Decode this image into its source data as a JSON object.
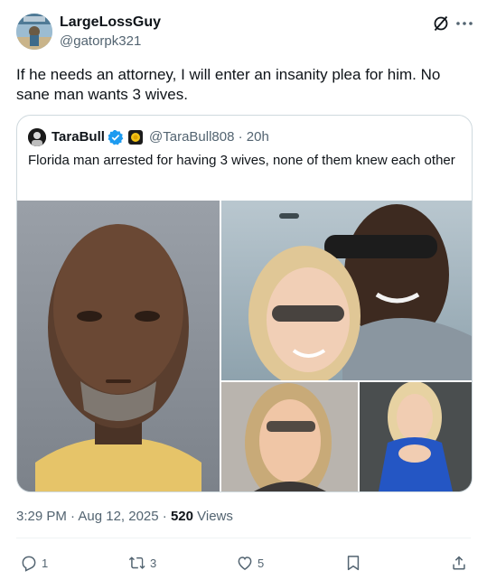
{
  "author": {
    "name": "LargeLossGuy",
    "handle": "@gatorpk321"
  },
  "tweet": {
    "text": "If he needs an attorney, I will enter an insanity plea for him. No sane man wants 3 wives."
  },
  "quoted": {
    "name": "TaraBull",
    "handle_time": "@TaraBull808 · 20h",
    "text": "Florida man arrested for having 3 wives, none of them knew each other"
  },
  "meta": {
    "timestamp": "3:29 PM · Aug 12, 2025 · ",
    "views_count": "520",
    "views_label": " Views"
  },
  "actions": {
    "replies": "1",
    "reposts": "3",
    "likes": "5"
  },
  "icons": {
    "grok": "grok-icon",
    "more": "more-icon",
    "verified": "verified-icon",
    "reply": "reply-icon",
    "repost": "repost-icon",
    "like": "heart-icon",
    "bookmark": "bookmark-icon",
    "share": "share-icon"
  },
  "colors": {
    "text": "#0f1419",
    "secondary": "#536471",
    "verified": "#1d9bf0",
    "border": "#cfd9de"
  }
}
